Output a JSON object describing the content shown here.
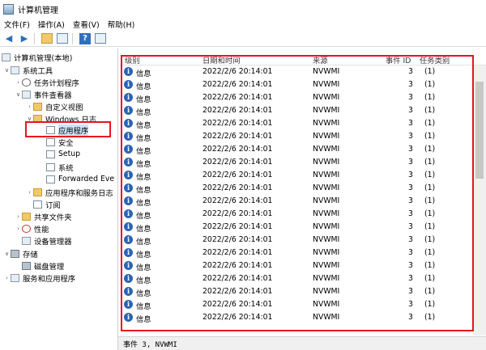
{
  "window": {
    "title": "计算机管理"
  },
  "menu": [
    {
      "label": "文件(F)"
    },
    {
      "label": "操作(A)"
    },
    {
      "label": "查看(V)"
    },
    {
      "label": "帮助(H)"
    }
  ],
  "toolbar": {
    "help_label": "?"
  },
  "tree": {
    "root": "计算机管理(本地)",
    "system_tools": "系统工具",
    "task_scheduler": "任务计划程序",
    "event_viewer": "事件查看器",
    "custom_views": "自定义视图",
    "windows_logs": "Windows 日志",
    "application": "应用程序",
    "security": "安全",
    "setup": "Setup",
    "system": "系统",
    "forwarded": "Forwarded Eve",
    "apps_services_logs": "应用程序和服务日志",
    "subscriptions": "订阅",
    "shared_folders": "共享文件夹",
    "performance": "性能",
    "device_manager": "设备管理器",
    "storage": "存储",
    "disk_management": "磁盘管理",
    "services_apps": "服务和应用程序"
  },
  "events": {
    "columns": {
      "level": "级别",
      "datetime": "日期和时间",
      "source": "来源",
      "event_id": "事件 ID",
      "task_category": "任务类别"
    },
    "rows": [
      {
        "level": "信息",
        "datetime": "2022/2/6 20:14:01",
        "source": "NVWMI",
        "event_id": "3",
        "category": "(1)"
      },
      {
        "level": "信息",
        "datetime": "2022/2/6 20:14:01",
        "source": "NVWMI",
        "event_id": "3",
        "category": "(1)"
      },
      {
        "level": "信息",
        "datetime": "2022/2/6 20:14:01",
        "source": "NVWMI",
        "event_id": "3",
        "category": "(1)"
      },
      {
        "level": "信息",
        "datetime": "2022/2/6 20:14:01",
        "source": "NVWMI",
        "event_id": "3",
        "category": "(1)"
      },
      {
        "level": "信息",
        "datetime": "2022/2/6 20:14:01",
        "source": "NVWMI",
        "event_id": "3",
        "category": "(1)"
      },
      {
        "level": "信息",
        "datetime": "2022/2/6 20:14:01",
        "source": "NVWMI",
        "event_id": "3",
        "category": "(1)"
      },
      {
        "level": "信息",
        "datetime": "2022/2/6 20:14:01",
        "source": "NVWMI",
        "event_id": "3",
        "category": "(1)"
      },
      {
        "level": "信息",
        "datetime": "2022/2/6 20:14:01",
        "source": "NVWMI",
        "event_id": "3",
        "category": "(1)"
      },
      {
        "level": "信息",
        "datetime": "2022/2/6 20:14:01",
        "source": "NVWMI",
        "event_id": "3",
        "category": "(1)"
      },
      {
        "level": "信息",
        "datetime": "2022/2/6 20:14:01",
        "source": "NVWMI",
        "event_id": "3",
        "category": "(1)"
      },
      {
        "level": "信息",
        "datetime": "2022/2/6 20:14:01",
        "source": "NVWMI",
        "event_id": "3",
        "category": "(1)"
      },
      {
        "level": "信息",
        "datetime": "2022/2/6 20:14:01",
        "source": "NVWMI",
        "event_id": "3",
        "category": "(1)"
      },
      {
        "level": "信息",
        "datetime": "2022/2/6 20:14:01",
        "source": "NVWMI",
        "event_id": "3",
        "category": "(1)"
      },
      {
        "level": "信息",
        "datetime": "2022/2/6 20:14:01",
        "source": "NVWMI",
        "event_id": "3",
        "category": "(1)"
      },
      {
        "level": "信息",
        "datetime": "2022/2/6 20:14:01",
        "source": "NVWMI",
        "event_id": "3",
        "category": "(1)"
      },
      {
        "level": "信息",
        "datetime": "2022/2/6 20:14:01",
        "source": "NVWMI",
        "event_id": "3",
        "category": "(1)"
      },
      {
        "level": "信息",
        "datetime": "2022/2/6 20:14:01",
        "source": "NVWMI",
        "event_id": "3",
        "category": "(1)"
      },
      {
        "level": "信息",
        "datetime": "2022/2/6 20:14:01",
        "source": "NVWMI",
        "event_id": "3",
        "category": "(1)"
      },
      {
        "level": "信息",
        "datetime": "2022/2/6 20:14:01",
        "source": "NVWMI",
        "event_id": "3",
        "category": "(1)"
      },
      {
        "level": "信息",
        "datetime": "2022/2/6 20:14:01",
        "source": "NVWMI",
        "event_id": "3",
        "category": "(1)"
      }
    ]
  },
  "status": {
    "text": "事件 3, NVWMI"
  },
  "colors": {
    "highlight_border": "#e8141e",
    "info_icon": "#2a64b4"
  }
}
